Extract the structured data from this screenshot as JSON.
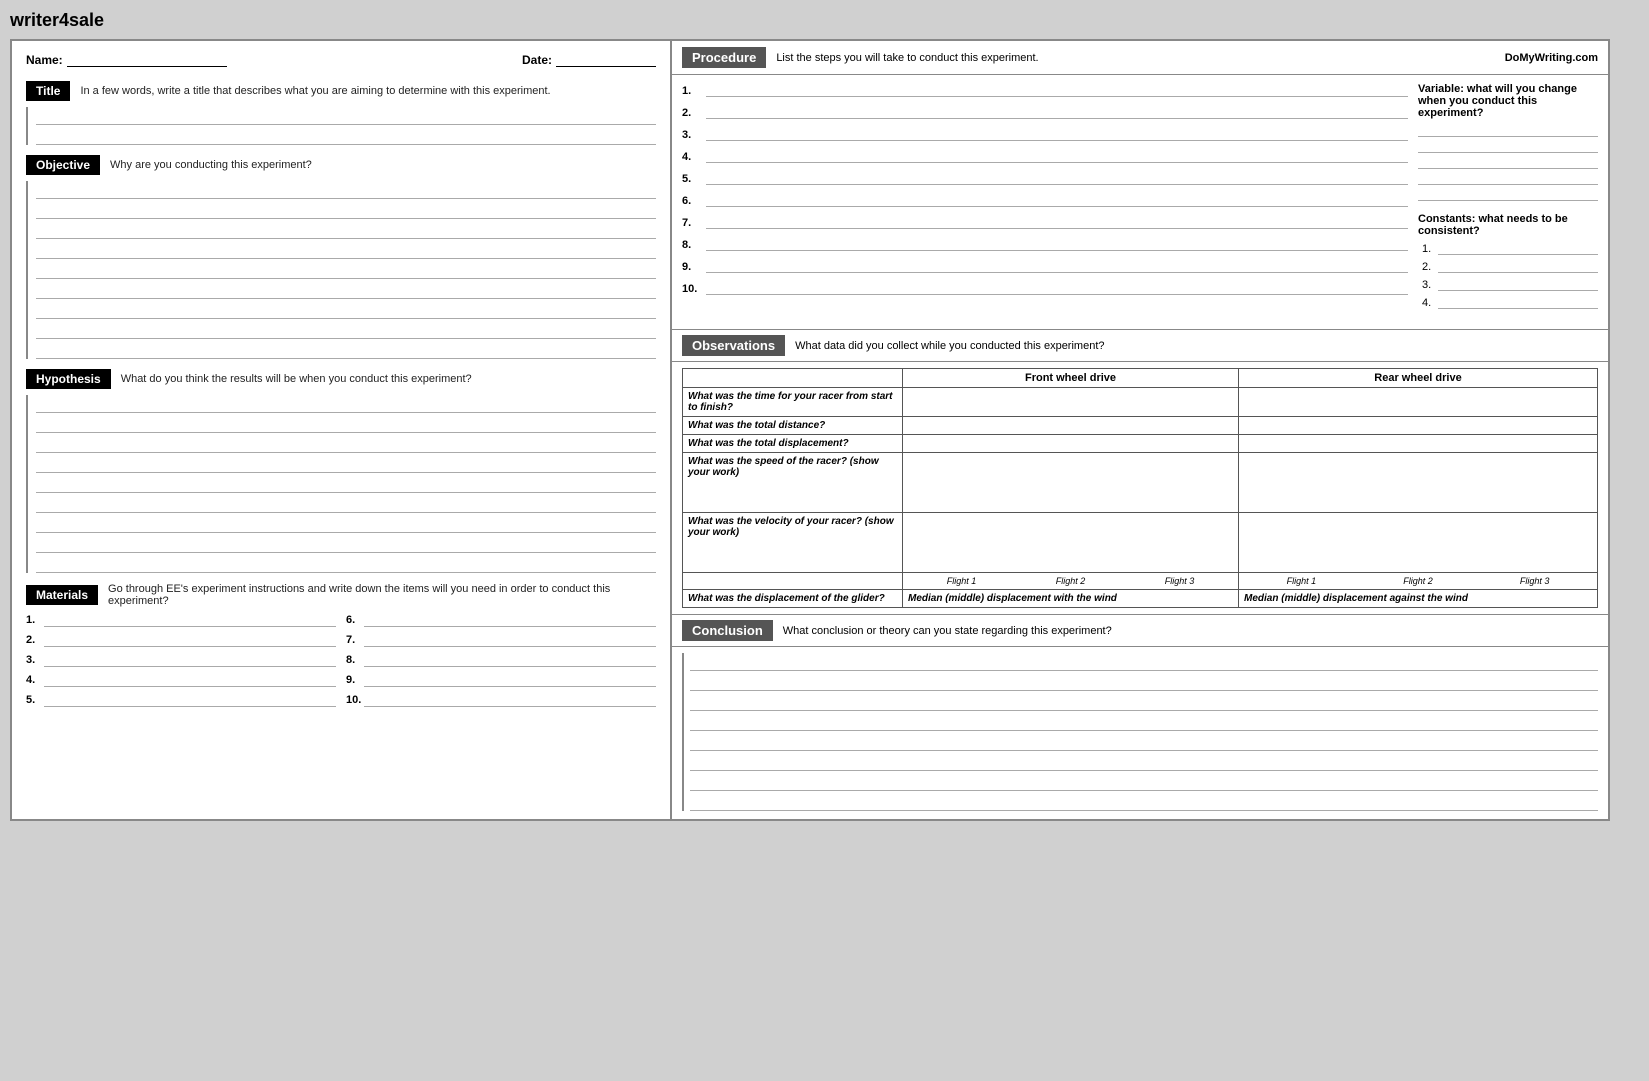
{
  "site": {
    "logo": "writer4sale"
  },
  "left": {
    "name_label": "Name:",
    "date_label": "Date:",
    "title_badge": "Title",
    "title_desc": "In a few words, write a title that describes what you are aiming to determine with this experiment.",
    "objective_badge": "Objective",
    "objective_desc": "Why are you conducting this experiment?",
    "hypothesis_badge": "Hypothesis",
    "hypothesis_desc": "What do you think the results will be when you conduct this experiment?",
    "materials_badge": "Materials",
    "materials_desc": "Go through EE's experiment instructions and write down the items will you need in order to conduct this experiment?",
    "materials_nums_left": [
      "1.",
      "2.",
      "3.",
      "4.",
      "5."
    ],
    "materials_nums_right": [
      "6.",
      "7.",
      "8.",
      "9.",
      "10."
    ]
  },
  "right": {
    "procedure_badge": "Procedure",
    "procedure_desc": "List the steps you will take to conduct this experiment.",
    "domywriting": "DoMyWriting.com",
    "proc_steps": [
      "1.",
      "2.",
      "3.",
      "4.",
      "5.",
      "6.",
      "7.",
      "8.",
      "9.",
      "10."
    ],
    "variable_title": "Variable: what will you change when you conduct this experiment?",
    "constants_title": "Constants: what needs to be consistent?",
    "constants_nums": [
      "1.",
      "2.",
      "3.",
      "4."
    ],
    "observations_badge": "Observations",
    "observations_desc": "What data did you collect while you conducted this experiment?",
    "obs_col_empty": "",
    "obs_col_front": "Front wheel drive",
    "obs_col_rear": "Rear wheel drive",
    "obs_rows": [
      {
        "question": "What was the time for your racer from start to finish?",
        "front": "",
        "rear": ""
      },
      {
        "question": "What was the total distance?",
        "front": "",
        "rear": ""
      },
      {
        "question": "What was the total displacement?",
        "front": "",
        "rear": ""
      },
      {
        "question": "What was the speed of the racer? (show your work)",
        "front": "",
        "rear": ""
      },
      {
        "question": "What was the velocity of your racer? (show your work)",
        "front": "",
        "rear": ""
      }
    ],
    "flight_headers": [
      "Flight 1",
      "Flight 2",
      "Flight 3",
      "Flight 1",
      "Flight 2",
      "Flight 3"
    ],
    "glider_question": "What was the displacement of the glider?",
    "glider_front_label": "Median (middle) displacement with the wind",
    "glider_rear_label": "Median (middle) displacement against the wind",
    "conclusion_badge": "Conclusion",
    "conclusion_desc": "What conclusion or theory can you state regarding this experiment?"
  }
}
